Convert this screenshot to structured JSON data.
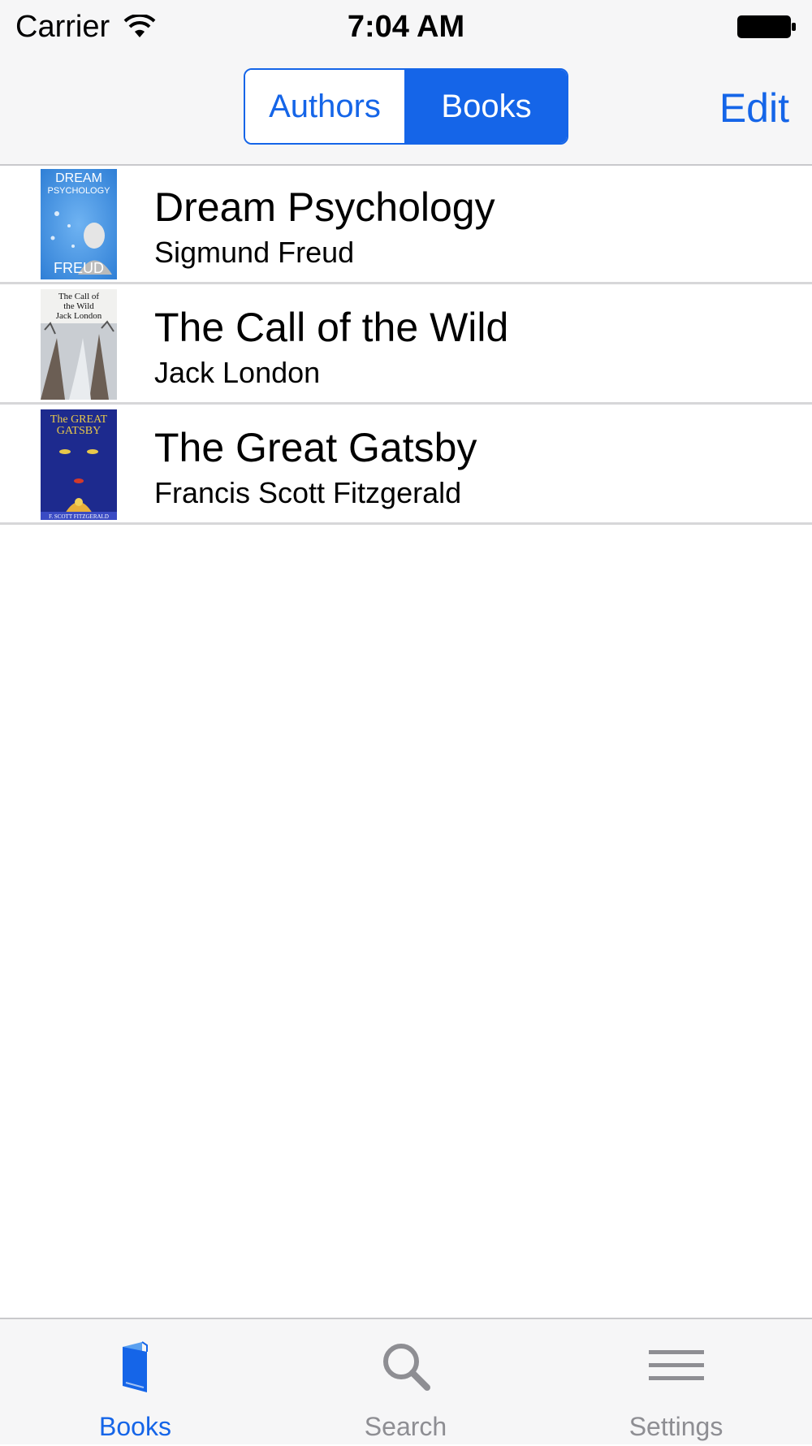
{
  "status_bar": {
    "carrier": "Carrier",
    "time": "7:04 AM"
  },
  "nav_bar": {
    "segments": [
      "Authors",
      "Books"
    ],
    "selected_segment": "Books",
    "edit_label": "Edit"
  },
  "books": [
    {
      "title": "Dream Psychology",
      "author": "Sigmund Freud",
      "cover_text": [
        "DREAM",
        "PSYCHOLOGY",
        "FREUD"
      ]
    },
    {
      "title": "The Call of the Wild",
      "author": "Jack London",
      "cover_text": [
        "The Call of",
        "the Wild",
        "Jack London"
      ]
    },
    {
      "title": "The Great Gatsby",
      "author": "Francis Scott Fitzgerald",
      "cover_text": [
        "The GREAT",
        "GATSBY",
        "F. SCOTT FITZGERALD"
      ]
    }
  ],
  "tab_bar": {
    "tabs": [
      {
        "label": "Books",
        "icon": "book-icon",
        "active": true
      },
      {
        "label": "Search",
        "icon": "search-icon",
        "active": false
      },
      {
        "label": "Settings",
        "icon": "menu-icon",
        "active": false
      }
    ]
  },
  "colors": {
    "accent": "#1565e8",
    "inactive": "#8e8e93",
    "bar_background": "#f6f6f7"
  }
}
